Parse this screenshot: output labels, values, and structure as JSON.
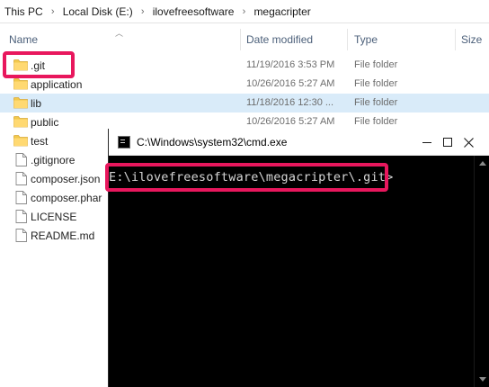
{
  "breadcrumb": [
    "This PC",
    "Local Disk (E:)",
    "ilovefreesoftware",
    "megacripter"
  ],
  "columns": {
    "name": "Name",
    "date": "Date modified",
    "type": "Type",
    "size": "Size"
  },
  "files": [
    {
      "name": ".git",
      "date": "11/19/2016 3:53 PM",
      "type": "File folder",
      "icon": "folder-icon"
    },
    {
      "name": "application",
      "date": "10/26/2016 5:27 AM",
      "type": "File folder",
      "icon": "folder-icon"
    },
    {
      "name": "lib",
      "date": "11/18/2016 12:30 ...",
      "type": "File folder",
      "icon": "folder-icon"
    },
    {
      "name": "public",
      "date": "10/26/2016 5:27 AM",
      "type": "File folder",
      "icon": "folder-icon"
    },
    {
      "name": "test",
      "date": "",
      "type": "",
      "icon": "folder-icon"
    },
    {
      "name": ".gitignore",
      "date": "",
      "type": "",
      "icon": "file-icon"
    },
    {
      "name": "composer.json",
      "date": "",
      "type": "",
      "icon": "file-icon"
    },
    {
      "name": "composer.phar",
      "date": "",
      "type": "",
      "icon": "file-icon"
    },
    {
      "name": "LICENSE",
      "date": "",
      "type": "",
      "icon": "file-icon"
    },
    {
      "name": "README.md",
      "date": "",
      "type": "",
      "icon": "file-icon"
    }
  ],
  "cmd": {
    "title": "C:\\Windows\\system32\\cmd.exe",
    "prompt": "E:\\ilovefreesoftware\\megacripter\\.git>"
  },
  "colors": {
    "highlight": "#e8175d",
    "selected_row": "#d9ebf9",
    "folder": "#f0c85a"
  }
}
